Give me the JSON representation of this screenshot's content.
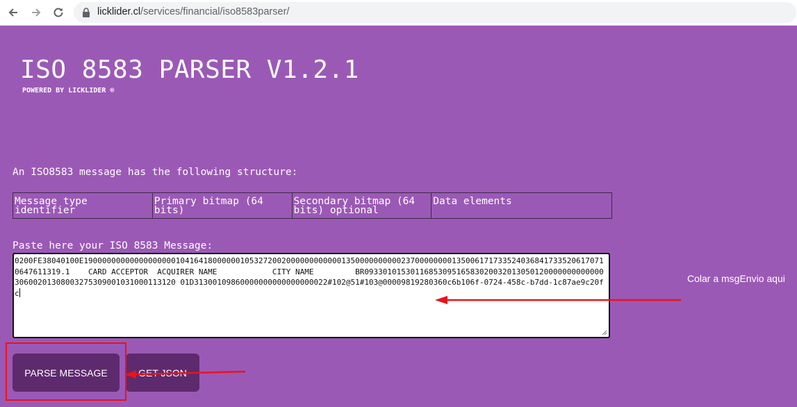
{
  "browser": {
    "url_host": "licklider.cl",
    "url_path": "/services/financial/iso8583parser/",
    "icons": [
      "back-arrow-icon",
      "forward-arrow-icon",
      "reload-icon",
      "lock-icon"
    ]
  },
  "page": {
    "title": "ISO 8583 PARSER V1.2.1",
    "subtitle": "POWERED BY LICKLIDER ®",
    "structure_intro": "An ISO8583 message has the following structure:",
    "structure_cells": [
      "Message type identifier",
      "Primary bitmap (64 bits)",
      "Secondary bitmap (64 bits) optional",
      "Data elements"
    ],
    "paste_label": "Paste here your ISO 8583 Message:",
    "message_value": "0200FE38040100E190000000000000000001041641800000010532720020000000000001350000000000237000000001350061717335240368417335206170710647611319.1    CARD ACCEPTOR  ACQUIRER NAME            CITY NAME         BR093301015301168530951658302003201305012000000000000030600201308003275309001031000113120 01D31300109860000000000000000022#102@51#103@00009819280360c6b106f-0724-458c-b7dd-1c87ae9c20fc",
    "annotation": "Colar a msgEnvio aqui",
    "buttons": {
      "parse_label": "PARSE MESSAGE",
      "json_label": "GET JSON"
    }
  },
  "colors": {
    "background": "#9b59b6",
    "button": "#5e2a6e",
    "annotation_red": "#e8141b"
  }
}
